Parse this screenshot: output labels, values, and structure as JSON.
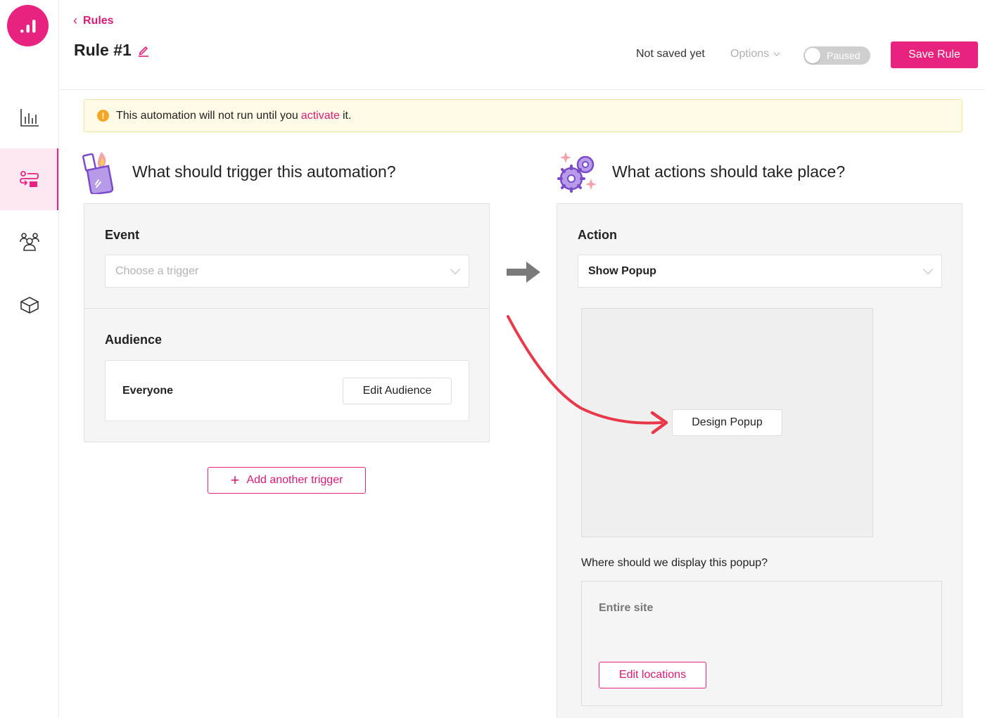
{
  "header": {
    "back_label": "Rules",
    "title": "Rule #1",
    "save_status": "Not saved yet",
    "options_label": "Options",
    "toggle_label": "Paused",
    "save_label": "Save Rule"
  },
  "banner": {
    "text_before": "This automation will not run until you",
    "link": "activate",
    "text_after": "it."
  },
  "trigger": {
    "heading": "What should trigger this automation?",
    "event_label": "Event",
    "event_placeholder": "Choose a trigger",
    "audience_label": "Audience",
    "audience_value": "Everyone",
    "edit_audience_label": "Edit Audience",
    "add_trigger_label": "Add another trigger"
  },
  "action": {
    "heading": "What actions should take place?",
    "action_label": "Action",
    "action_value": "Show Popup",
    "design_label": "Design Popup",
    "display_question": "Where should we display this popup?",
    "location_value": "Entire site",
    "edit_locations_label": "Edit locations"
  },
  "colors": {
    "accent": "#e7237f",
    "banner_bg": "#fffbe6",
    "warning": "#f5a623",
    "arrow_red": "#e8384a"
  },
  "icons": [
    "logo-bars-icon",
    "analytics-icon",
    "rules-icon",
    "audience-icon",
    "box-icon",
    "pencil-icon",
    "warning-icon",
    "lighter-icon",
    "gears-icon",
    "right-arrow-icon",
    "chevron-down-icon",
    "plus-icon"
  ]
}
